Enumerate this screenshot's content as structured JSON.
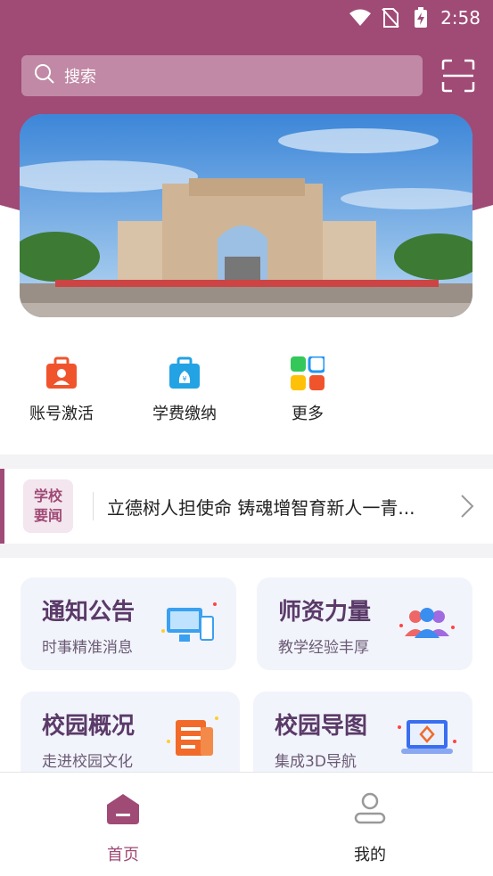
{
  "status_bar": {
    "time": "2:58"
  },
  "search": {
    "placeholder": "搜索"
  },
  "quick_actions": [
    {
      "label": "账号激活",
      "icon": "briefcase-user-icon"
    },
    {
      "label": "学费缴纳",
      "icon": "money-bag-icon"
    },
    {
      "label": "更多",
      "icon": "grid-more-icon"
    }
  ],
  "news": {
    "tag_line1": "学校",
    "tag_line2": "要闻",
    "headline": "立德树人担使命 铸魂增智育新人一青..."
  },
  "cards": [
    {
      "title": "通知公告",
      "subtitle": "时事精准消息",
      "icon": "monitor-icon"
    },
    {
      "title": "师资力量",
      "subtitle": "教学经验丰厚",
      "icon": "people-icon"
    },
    {
      "title": "校园概况",
      "subtitle": "走进校园文化",
      "icon": "newspaper-icon"
    },
    {
      "title": "校园导图",
      "subtitle": "集成3D导航",
      "icon": "laptop-map-icon"
    }
  ],
  "tabs": [
    {
      "label": "首页",
      "active": true
    },
    {
      "label": "我的",
      "active": false
    }
  ],
  "colors": {
    "brand": "#a04a76",
    "card_bg": "#f2f4fb"
  }
}
